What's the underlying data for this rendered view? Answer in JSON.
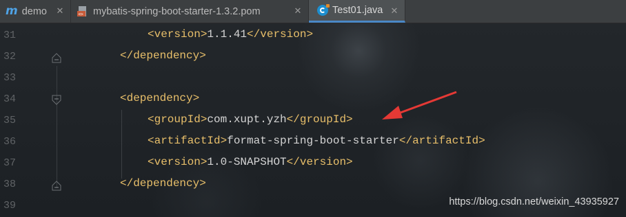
{
  "tabs": [
    {
      "label": "demo",
      "icon": "maven-m-icon",
      "active": false
    },
    {
      "label": "mybatis-spring-boot-starter-1.3.2.pom",
      "icon": "pom-file-icon",
      "active": false
    },
    {
      "label": "Test01.java",
      "icon": "java-class-icon",
      "active": true
    }
  ],
  "close_glyph": "✕",
  "editor": {
    "lines": [
      {
        "num": "31",
        "open": "<version>",
        "text": "1.1.41",
        "close": "</version>"
      },
      {
        "num": "32",
        "open": "</dependency>",
        "text": "",
        "close": ""
      },
      {
        "num": "33",
        "open": "",
        "text": "",
        "close": ""
      },
      {
        "num": "34",
        "open": "<dependency>",
        "text": "",
        "close": ""
      },
      {
        "num": "35",
        "open": "<groupId>",
        "text": "com.xupt.yzh",
        "close": "</groupId>"
      },
      {
        "num": "36",
        "open": "<artifactId>",
        "text": "format-spring-boot-starter",
        "close": "</artifactId>"
      },
      {
        "num": "37",
        "open": "<version>",
        "text": "1.0-SNAPSHOT",
        "close": "</version>"
      },
      {
        "num": "38",
        "open": "</dependency>",
        "text": "",
        "close": ""
      },
      {
        "num": "39",
        "open": "",
        "text": "",
        "close": ""
      }
    ]
  },
  "annotation": {
    "color": "#e53935"
  },
  "watermark": "https://blog.csdn.net/weixin_43935927",
  "colors": {
    "tag": "#e8bf6a",
    "text": "#d4d4d4",
    "line_number": "#606366",
    "active_tab_underline": "#4a88c7"
  }
}
